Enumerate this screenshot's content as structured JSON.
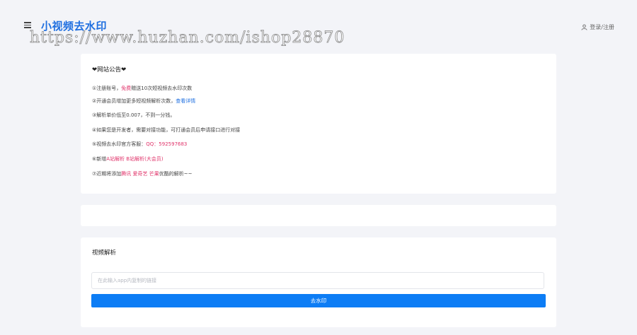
{
  "header": {
    "site_title": "小视频去水印",
    "watermark_text": "https://www.huzhan.com/ishop28870",
    "login_label": "登录/注册"
  },
  "notice": {
    "title": "❤网站公告❤",
    "line1": {
      "a": "①注册账号，",
      "b": "免费",
      "c": "赠送10次短视频去水印次数"
    },
    "line2": {
      "a": "②开通会员增加更多短视频解析次数，",
      "b": "查看详情"
    },
    "line3": "③解析单价低至0.007，不到一分钱。",
    "line4": "④如果您是开发者，需要对接功能，可打通会员后申请接口进行对接",
    "line5": {
      "a": "⑤视频去水印官方客服：",
      "b": "QQ：592597683"
    },
    "line6": {
      "a": "⑥新增",
      "b": "A站解析 B站解析(大会员)"
    },
    "line7": {
      "a": "⑦近期将添加",
      "b": "腾讯 爱奇艺 芒果",
      "c": "优酷的解析~~"
    }
  },
  "parse": {
    "title": "视频解析",
    "input_placeholder": "在此输入app内复制的链接",
    "input_value": "",
    "button_label": "去水印"
  },
  "colors": {
    "accent": "#1f6fe0",
    "button": "#0d7df5",
    "highlight": "#e0336a",
    "background": "#f3f4f8"
  },
  "icons": {
    "menu": "menu-icon",
    "user": "user-icon"
  }
}
